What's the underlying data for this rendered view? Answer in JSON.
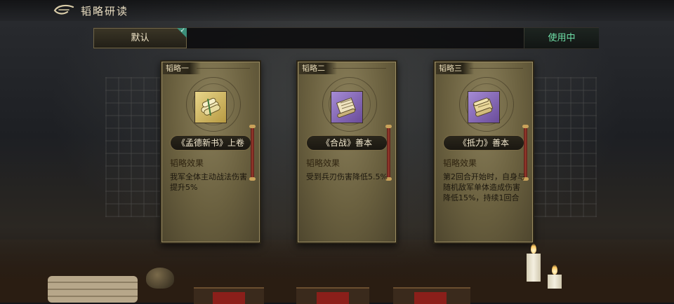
{
  "header": {
    "title": "韬略研读",
    "back_icon": "back-arrow-icon"
  },
  "tabs": {
    "default_label": "默认",
    "in_use_label": "使用中",
    "selected_check_color": "#3c8f7a",
    "in_use_color": "#6fe0a8"
  },
  "cards": [
    {
      "tag": "韬略一",
      "name": "《孟德新书》上卷",
      "effect_label": "韬略效果",
      "effect": "我军全体主动战法伤害提升5%",
      "icon": "gold-scroll-icon"
    },
    {
      "tag": "韬略二",
      "name": "《合战》善本",
      "effect_label": "韬略效果",
      "effect": "受到兵刃伤害降低5.5%",
      "icon": "purple-scroll-icon"
    },
    {
      "tag": "韬略三",
      "name": "《抵力》善本",
      "effect_label": "韬略效果",
      "effect": "第2回合开始时，自身与随机敌军单体造成伤害降低15%，持续1回合",
      "icon": "purple-scroll-icon"
    }
  ]
}
